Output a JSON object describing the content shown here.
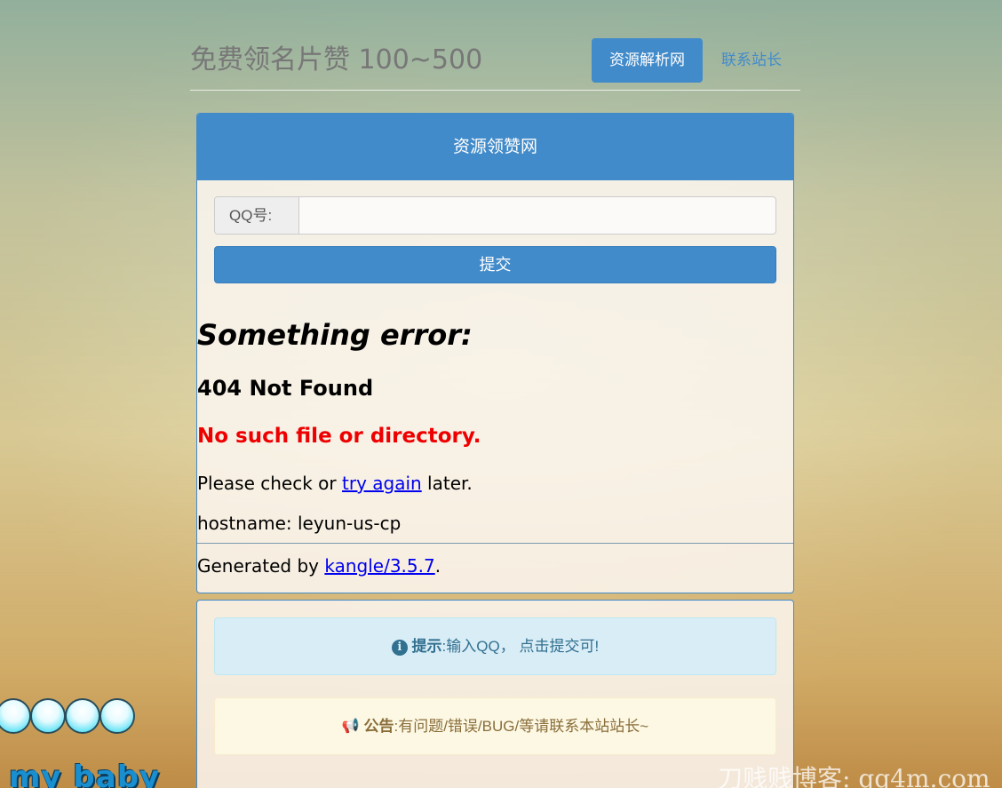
{
  "header": {
    "site_title": "免费领名片赞 100~500",
    "nav_active": "资源解析网",
    "nav_link": "联系站长"
  },
  "main_panel": {
    "heading": "资源领赞网",
    "qq_label": "QQ号:",
    "qq_value": "",
    "submit_label": "提交"
  },
  "error": {
    "title": "Something error:",
    "code": "404 Not Found",
    "message": "No such file or directory.",
    "check_prefix": "Please check or ",
    "check_link": "try again",
    "check_suffix": " later.",
    "hostname": "hostname: leyun-us-cp",
    "generated_prefix": "Generated by ",
    "generated_link": "kangle/3.5.7",
    "generated_suffix": "."
  },
  "info_panel": {
    "tip_label": "提示",
    "tip_text": ":输入QQ， 点击提交可!",
    "notice_label": "公告",
    "notice_text": ":有问题/错误/BUG/等请联系本站站长~"
  },
  "decor": {
    "baby_text": "my baby",
    "watermark": "刀贱贱博客: qq4m.com"
  },
  "colors": {
    "primary": "#428bca",
    "info_bg": "#d9edf7",
    "warn_bg": "#fcf8e3",
    "error_red": "#ee0000"
  },
  "icons": [
    "info-circle-icon",
    "bullhorn-icon"
  ]
}
